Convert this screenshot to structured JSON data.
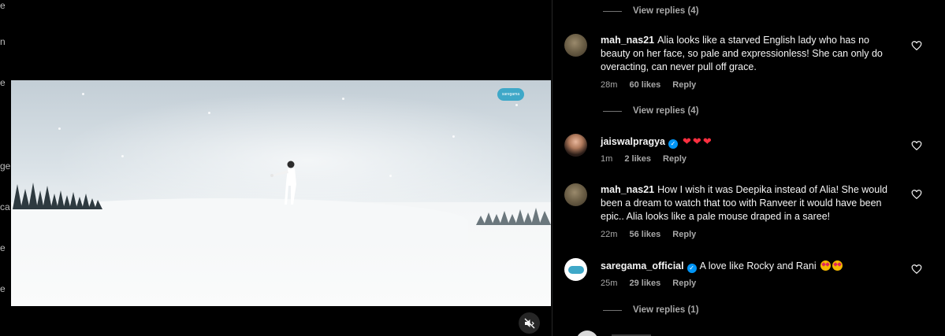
{
  "left_edge_letters": [
    "e",
    "n",
    "e",
    "ge",
    "ca",
    "e",
    "e"
  ],
  "video": {
    "logo_text": "saregama"
  },
  "comments_panel": {
    "view_replies_top": "View replies (4)",
    "comments": [
      {
        "username": "mah_nas21",
        "verified": false,
        "text": "Alia looks like a starved English lady who has no beauty on her face, so pale and expressionless! She can only do overacting, can never pull off grace.",
        "time": "28m",
        "likes": "60 likes",
        "reply": "Reply",
        "view_replies": "View replies (4)"
      },
      {
        "username": "jaiswalpragya",
        "verified": true,
        "text": "",
        "hearts": [
          "❤",
          "❤",
          "❤"
        ],
        "time": "1m",
        "likes": "2 likes",
        "reply": "Reply"
      },
      {
        "username": "mah_nas21",
        "verified": false,
        "text": "How I wish it was Deepika instead of Alia! She would been a dream to watch that too with Ranveer it would have been epic.. Alia looks like a pale mouse draped in a saree!",
        "time": "22m",
        "likes": "56 likes",
        "reply": "Reply"
      },
      {
        "username": "saregama_official",
        "verified": true,
        "text": "A love like Rocky and Rani",
        "time": "25m",
        "likes": "29 likes",
        "reply": "Reply",
        "view_replies": "View replies (1)"
      }
    ]
  },
  "colors": {
    "background": "#000000",
    "muted_text": "#a8a8a8",
    "verified_blue": "#0095f6",
    "heart_red": "#ff3040"
  }
}
